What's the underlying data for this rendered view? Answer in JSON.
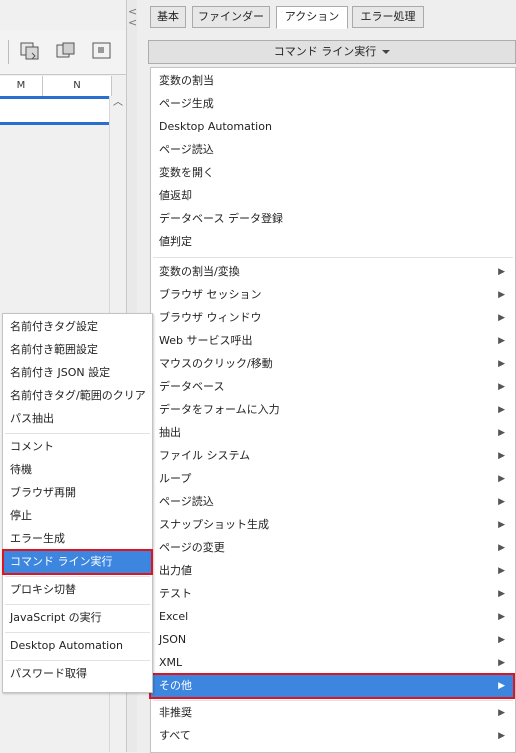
{
  "tabs": [
    {
      "label": "基本"
    },
    {
      "label": "ファインダー"
    },
    {
      "label": "アクション"
    },
    {
      "label": "エラー処理"
    }
  ],
  "active_tab": "アクション",
  "columns": {
    "col1": "M",
    "col2": "N"
  },
  "command_dropdown": {
    "label": "コマンド ライン実行"
  },
  "main_menu": {
    "group1": [
      "変数の割当",
      "ページ生成",
      "Desktop Automation",
      "ページ読込",
      "変数を開く",
      "値返却",
      "データベース データ登録",
      "値判定"
    ],
    "group2": [
      "変数の割当/変換",
      "ブラウザ セッション",
      "ブラウザ ウィンドウ",
      "Web サービス呼出",
      "マウスのクリック/移動",
      "データベース",
      "データをフォームに入力",
      "抽出",
      "ファイル システム",
      "ループ",
      "ページ読込",
      "スナップショット生成",
      "ページの変更",
      "出力値",
      "テスト",
      "Excel",
      "JSON",
      "XML",
      "その他",
      "非推奨",
      "すべて"
    ]
  },
  "sub_menu": {
    "group1": [
      "名前付きタグ設定",
      "名前付き範囲設定",
      "名前付き JSON 設定",
      "名前付きタグ/範囲のクリア",
      "パス抽出"
    ],
    "group2": [
      "コメント",
      "待機",
      "ブラウザ再開",
      "停止",
      "エラー生成",
      "コマンド ライン実行"
    ],
    "group3": [
      "プロキシ切替"
    ],
    "group4": [
      "JavaScript の実行"
    ],
    "group5": [
      "Desktop Automation"
    ],
    "group6": [
      "パスワード取得"
    ]
  },
  "colors": {
    "highlight": "#3d86e0",
    "annotation_red": "#e0141e",
    "scroll_line": "#2a6fd0"
  }
}
